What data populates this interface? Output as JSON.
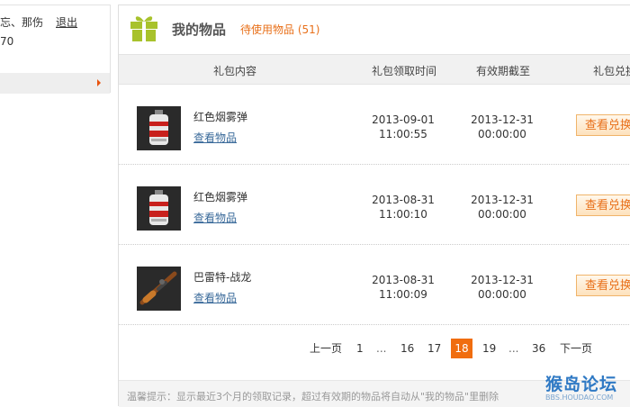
{
  "left": {
    "user_text": "忘、那伤",
    "logout_label": "退出",
    "number": "70"
  },
  "header": {
    "title": "我的物品",
    "subtitle": "待使用物品 (51)"
  },
  "table": {
    "columns": [
      "礼包内容",
      "礼包领取时间",
      "有效期截至",
      "礼包兑换"
    ],
    "rows": [
      {
        "name": "红色烟雾弹",
        "link": "查看物品",
        "claim_date": "2013-09-01",
        "claim_time": "11:00:55",
        "expire_date": "2013-12-31",
        "expire_time": "00:00:00",
        "button": "查看兑换",
        "thumb": "smoke-grenade"
      },
      {
        "name": "红色烟雾弹",
        "link": "查看物品",
        "claim_date": "2013-08-31",
        "claim_time": "11:00:10",
        "expire_date": "2013-12-31",
        "expire_time": "00:00:00",
        "button": "查看兑换",
        "thumb": "smoke-grenade"
      },
      {
        "name": "巴雷特-战龙",
        "link": "查看物品",
        "claim_date": "2013-08-31",
        "claim_time": "11:00:09",
        "expire_date": "2013-12-31",
        "expire_time": "00:00:00",
        "button": "查看兑换",
        "thumb": "sniper-rifle"
      }
    ]
  },
  "pager": {
    "prev": "上一页",
    "next": "下一页",
    "items": [
      "1",
      "...",
      "16",
      "17",
      "18",
      "19",
      "...",
      "36"
    ],
    "current": "18"
  },
  "tip": "温馨提示：显示最近3个月的领取记录，超过有效期的物品将自动从\"我的物品\"里删除",
  "watermark": {
    "main": "猴岛论坛",
    "url": "BBS.HOUDAO.COM"
  },
  "colors": {
    "accent": "#f06d0f",
    "link": "#3a6a9a",
    "gift_icon": "#a8c22c"
  }
}
